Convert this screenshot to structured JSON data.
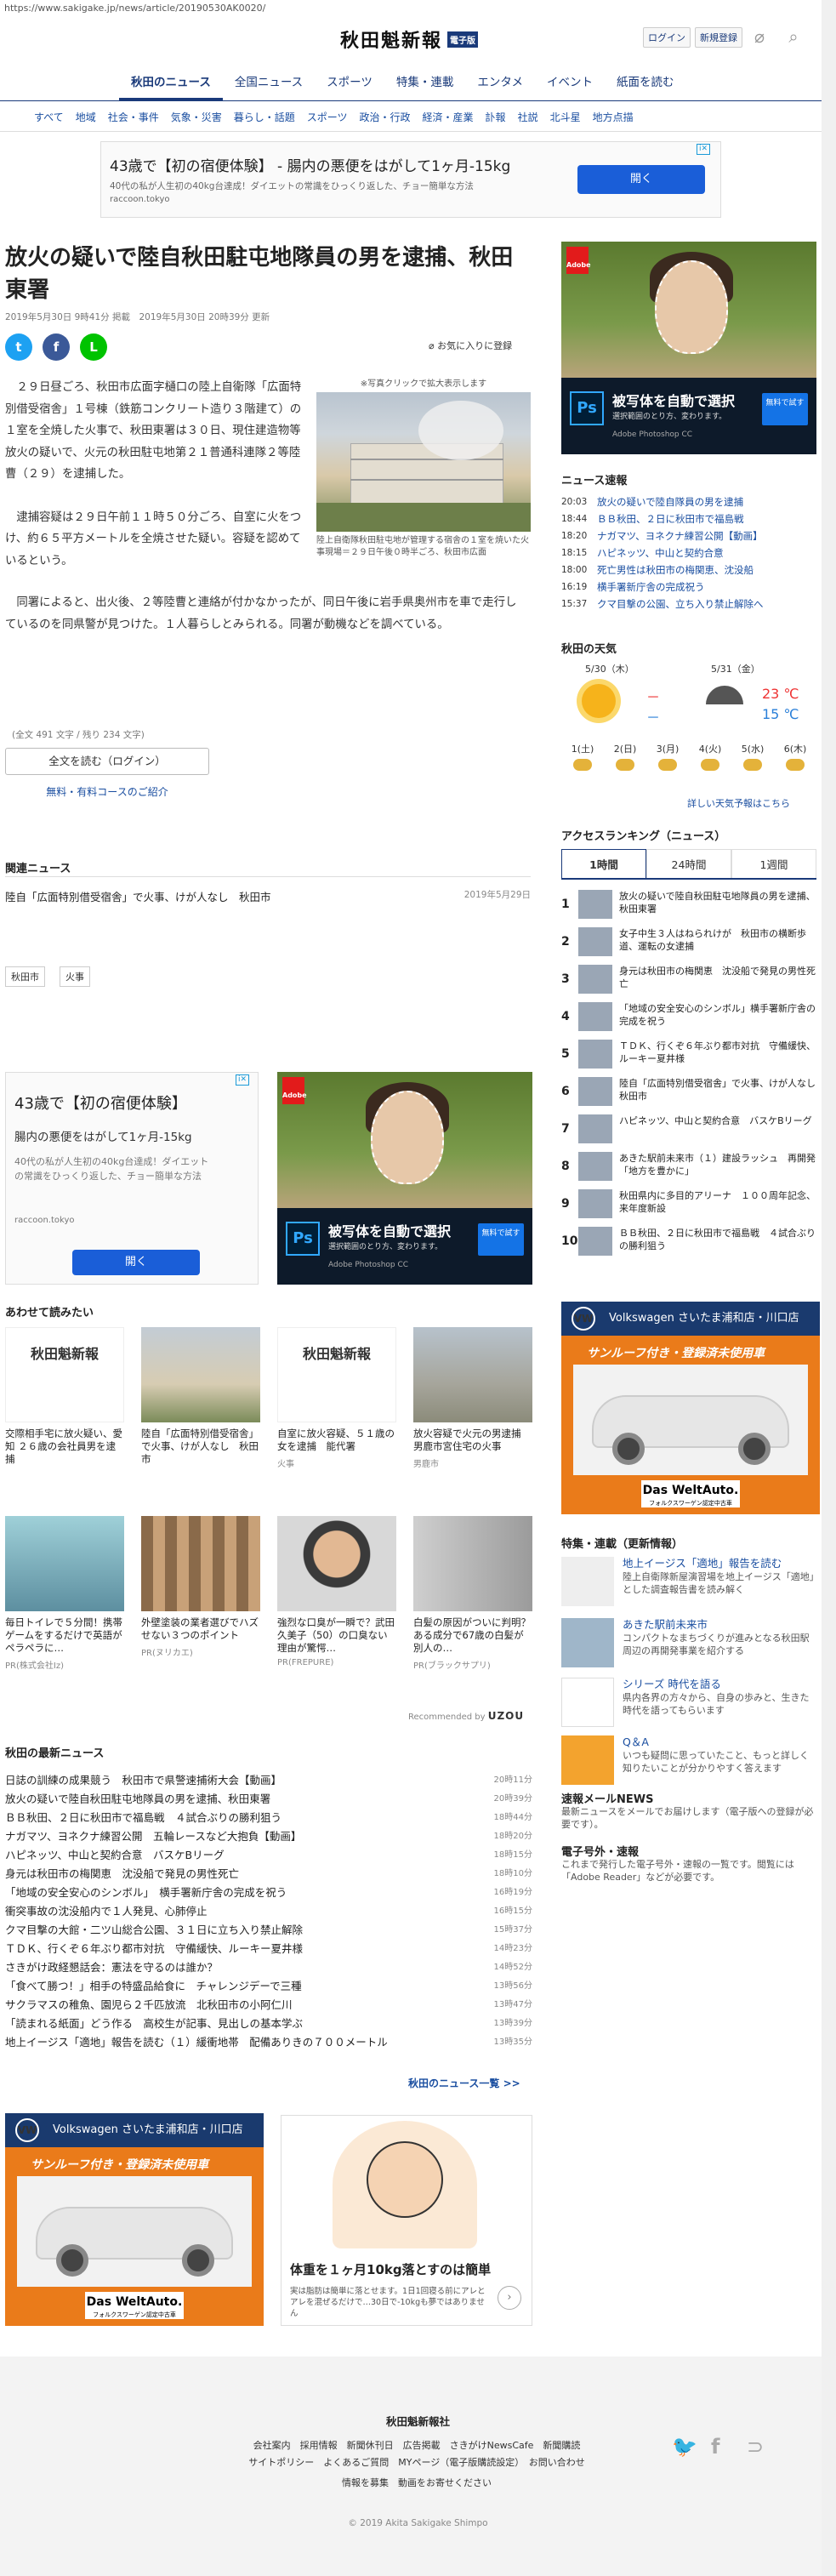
{
  "url": "https://www.sakigake.jp/news/article/20190530AK0020/",
  "header": {
    "logo": "秋田魁新報",
    "logo_box": "電子版",
    "login": "ログイン",
    "register": "新規登録"
  },
  "gnav": [
    "秋田のニュース",
    "全国ニュース",
    "スポーツ",
    "特集・連載",
    "エンタメ",
    "イベント",
    "紙面を読む"
  ],
  "subnav": [
    "すべて",
    "地域",
    "社会・事件",
    "気象・災害",
    "暮らし・話題",
    "スポーツ",
    "政治・行政",
    "経済・産業",
    "訃報",
    "社説",
    "北斗星",
    "地方点描"
  ],
  "top_ad": {
    "title": "43歳で【初の宿便体験】 - 腸内の悪便をはがして1ヶ月-15kg",
    "desc": "40代の私が人生初の40kg台達成！ダイエットの常識をひっくり返した、チョー簡単な方法",
    "source": "raccoon.tokyo",
    "open": "開く"
  },
  "article": {
    "title": "放火の疑いで陸自秋田駐屯地隊員の男を逮捕、秋田東署",
    "published": "2019年5月30日 9時41分 掲載",
    "updated": "2019年5月30日 20時39分 更新",
    "favorite": "お気に入りに登録",
    "photo_note": "※写真クリックで拡大表示します",
    "photo_caption": "陸上自衛隊秋田駐屯地が管理する宿舎の１室を焼いた火事現場＝２９日午後０時半ごろ、秋田市広面",
    "p1": "２９日昼ごろ、秋田市広面字樋口の陸上自衛隊「広面特別借受宿舎」１号棟（鉄筋コンクリート造り３階建て）の１室を全焼した火事で、秋田東署は３０日、現住建造物等放火の疑いで、火元の秋田駐屯地第２１普通科連隊２等陸曹（２９）を逮捕した。",
    "p2": "逮捕容疑は２９日午前１１時５０分ごろ、自室に火をつけ、約６５平方メートルを全焼させた疑い。容疑を認めているという。",
    "p3": "同署によると、出火後、２等陸曹と連絡が付かなかったが、同日午後に岩手県奥州市を車で走行しているのを同県警が見つけた。１人暮らしとみられる。同署が動機などを調べている。",
    "chars": "(全文 491 文字 / 残り 234 文字)",
    "read_full": "全文を読む（ログイン）",
    "plans": "無料・有料コースのご紹介"
  },
  "related": {
    "heading": "関連ニュース",
    "item": "陸自「広面特別借受宿舎」で火事、けが人なし　秋田市",
    "date": "2019年5月29日",
    "tags": [
      "秋田市",
      "火事"
    ]
  },
  "ad2": {
    "title": "43歳で【初の宿便体験】",
    "sub": "腸内の悪便をはがして1ヶ月-15kg",
    "desc": "40代の私が人生初の40kg台達成！ダイエットの常識をひっくり返した、チョー簡単な方法",
    "source": "raccoon.tokyo",
    "open": "開く"
  },
  "ps_ad": {
    "brand": "Adobe",
    "ps": "Ps",
    "headline": "被写体を自動で選択",
    "sub": "選択範囲のとり方、変わります。",
    "product": "Adobe Photoshop CC",
    "btn": "無料で試す"
  },
  "recommend": {
    "heading": "あわせて読みたい",
    "items": [
      {
        "text": "交際相手宅に放火疑い、愛知 ２６歳の会社員男を逮捕",
        "src": ""
      },
      {
        "text": "陸自「広面特別借受宿舎」で火事、けが人なし　秋田市",
        "src": ""
      },
      {
        "text": "自室に放火容疑、５１歳の女を逮捕　能代署",
        "src": "火事"
      },
      {
        "text": "放火容疑で火元の男逮捕　男鹿市宮住宅の火事",
        "src": "男鹿市"
      },
      {
        "text": "毎日トイレで５分間！携帯ゲームをするだけで英語がペラペラに…",
        "src": "PR(株式会社Iz)"
      },
      {
        "text": "外壁塗装の業者選びでハズせない３つのポイント",
        "src": "PR(ヌリカエ)"
      },
      {
        "text": "強烈な口臭が一瞬で？武田久美子（50）の口臭ない理由が驚愕…",
        "src": "PR(FREPURE)"
      },
      {
        "text": "白髪の原因がついに判明？ある成分で67歳の白髪が別人の…",
        "src": "PR(ブラックサプリ)"
      }
    ],
    "by": "Recommended by",
    "by_brand": "UZOU"
  },
  "latest": {
    "heading": "秋田の最新ニュース",
    "rows": [
      {
        "t": "日誌の訓練の成果競う　秋田市で県警速捕術大会【動画】",
        "d": "20時11分"
      },
      {
        "t": "放火の疑いで陸自秋田駐屯地隊員の男を逮捕、秋田東署",
        "d": "20時39分"
      },
      {
        "t": "ＢＢ秋田、２日に秋田市で福島戦　４試合ぶりの勝利狙う",
        "d": "18時44分"
      },
      {
        "t": "ナガマツ、ヨネクナ練習公開　五輪レースなど大抱負【動画】",
        "d": "18時20分"
      },
      {
        "t": "ハピネッツ、中山と契約合意　バスケBリーグ",
        "d": "18時15分"
      },
      {
        "t": "身元は秋田市の梅関恵　沈没船で発見の男性死亡",
        "d": "18時10分"
      },
      {
        "t": "「地域の安全安心のシンボル」　横手署新庁舎の完成を祝う",
        "d": "16時19分"
      },
      {
        "t": "衝突事故の沈没船内で１人発見、心肺停止",
        "d": "16時15分"
      },
      {
        "t": "クマ目撃の大館・二ツ山総合公園、３１日に立ち入り禁止解除",
        "d": "15時37分"
      },
      {
        "t": "ＴＤＫ、行くぞ６年ぶり都市対抗　守備緩快、ルーキー夏井様",
        "d": "14時23分"
      },
      {
        "t": "さきがけ政経懇話会：憲法を守るのは誰か？",
        "d": "14時52分"
      },
      {
        "t": "「食べて勝つ！」相手の特盛品給食に　チャレンジデーで三種",
        "d": "13時56分"
      },
      {
        "t": "サクラマスの稚魚、園児ら２千匹放流　北秋田市の小阿仁川",
        "d": "13時47分"
      },
      {
        "t": "「読まれる紙面」どう作る　高校生が記事、見出しの基本学ぶ",
        "d": "13時39分"
      },
      {
        "t": "地上イージス「適地」報告を読む（１）緩衝地帯　配備ありきの７００メートル",
        "d": "13時35分"
      }
    ],
    "more": "秋田のニュース一覧 >>"
  },
  "vw_ad": {
    "brand": "Volkswagen",
    "dealer": "さいたま浦和店・川口店",
    "tagline": "サンルーフ付き・登録済未使用車",
    "logo_main": "Das WeltAuto.",
    "logo_sub": "フォルクスワーゲン認定中古車"
  },
  "diet_ad": {
    "headline": "体重を１ヶ月10kg落とすのは簡単",
    "sub": "実は脂肪は簡単に落とせます。1日1回寝る前にアレとアレを混ぜるだけで…30日で-10kgも夢ではありません"
  },
  "sidebar": {
    "flash_heading": "ニュース速報",
    "flash": [
      {
        "t": "20:03",
        "x": "放火の疑いで陸自隊員の男を逮捕"
      },
      {
        "t": "18:44",
        "x": "ＢＢ秋田、２日に秋田市で福島戦"
      },
      {
        "t": "18:20",
        "x": "ナガマツ、ヨネクナ練習公開【動画】"
      },
      {
        "t": "18:15",
        "x": "ハピネッツ、中山と契約合意"
      },
      {
        "t": "18:00",
        "x": "死亡男性は秋田市の梅関恵、沈没船"
      },
      {
        "t": "16:19",
        "x": "横手署新庁舎の完成祝う"
      },
      {
        "t": "15:37",
        "x": "クマ目撃の公園、立ち入り禁止解除へ"
      }
    ],
    "weather_heading": "秋田の天気",
    "w_day1": "5/30（木）",
    "w_day2": "5/31（金）",
    "w_hi1": "－",
    "w_lo1": "－",
    "w_hi2": "23 ℃",
    "w_lo2": "15 ℃",
    "w_days": [
      "1(土)",
      "2(日)",
      "3(月)",
      "4(火)",
      "5(水)",
      "6(木)"
    ],
    "w_more": "詳しい天気予報はこちら",
    "rank_heading": "アクセスランキング（ニュース）",
    "rank_tabs": [
      "1時間",
      "24時間",
      "1週間"
    ],
    "ranks": [
      "放火の疑いで陸自秋田駐屯地隊員の男を逮捕、秋田東署",
      "女子中生３人はねられけが　秋田市の横断歩道、運転の女逮捕",
      "身元は秋田市の梅関恵　沈没船で発見の男性死亡",
      "「地域の安全安心のシンボル」横手署新庁舎の完成を祝う",
      "ＴＤＫ、行くぞ６年ぶり都市対抗　守備緩快、ルーキー夏井様",
      "陸自「広面特別借受宿舎」で火事、けが人なし　秋田市",
      "ハピネッツ、中山と契約合意　バスケBリーグ",
      "あきた駅前未来市（１）建設ラッシュ　再開発「地方を豊かに」",
      "秋田県内に多目的アリーナ　１００周年記念、来年度新設",
      "ＢＢ秋田、２日に秋田市で福島戦　４試合ぶりの勝利狙う"
    ],
    "feat_heading": "特集・連載（更新情報）",
    "feats": [
      {
        "tt": "地上イージス「適地」報告を読む",
        "ds": "陸上自衛隊新屋演習場を地上イージス「適地」とした調査報告書を読み解く"
      },
      {
        "tt": "あきた駅前未来市",
        "ds": "コンパクトなまちづくりが進みとなる秋田駅周辺の再開発事業を紹介する"
      },
      {
        "tt": "シリーズ 時代を語る",
        "ds": "県内各界の方々から、自身の歩みと、生きた時代を語ってもらいます"
      },
      {
        "tt": "Q＆A",
        "ds": "いつも疑問に思っていたこと、もっと詳しく知りたいことが分かりやすく答えます"
      }
    ],
    "mail_heading": "速報メールNEWS",
    "mail_text": "最新ニュースをメールでお届けします（電子版への登録が必要です）。",
    "pdf_heading": "電子号外・速報",
    "pdf_text": "これまで発行した電子号外・速報の一覧です。閲覧には「Adobe Reader」などが必要です。"
  },
  "footer": {
    "title": "秋田魁新報社",
    "links1": "会社案内　採用情報　新聞休刊日　広告掲載　さきがけNewsCafe　新聞購読",
    "links2": "サイトポリシー　よくあるご質問　MYページ（電子版購読設定）　お問い合わせ",
    "links3": "情報を募集　動画をお寄せください",
    "copy": "© 2019 Akita Sakigake Shimpo"
  }
}
